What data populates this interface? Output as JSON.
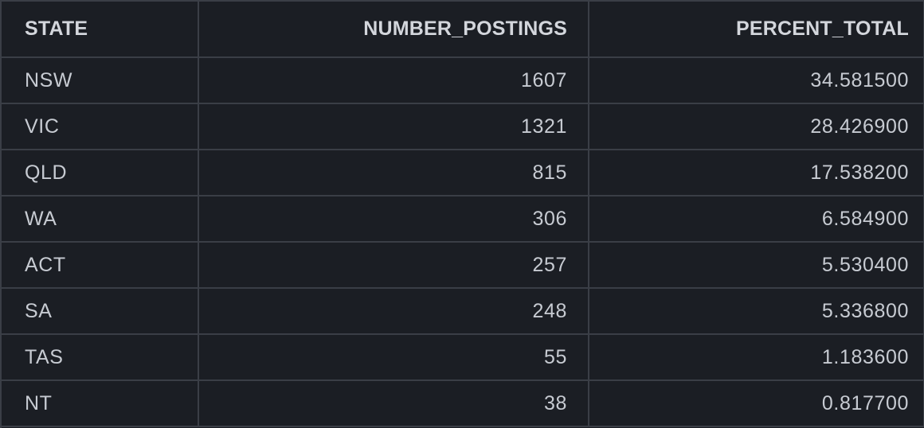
{
  "table": {
    "columns": [
      "STATE",
      "NUMBER_POSTINGS",
      "PERCENT_TOTAL"
    ],
    "rows": [
      [
        "NSW",
        "1607",
        "34.581500"
      ],
      [
        "VIC",
        "1321",
        "28.426900"
      ],
      [
        "QLD",
        "815",
        "17.538200"
      ],
      [
        "WA",
        "306",
        "6.584900"
      ],
      [
        "ACT",
        "257",
        "5.530400"
      ],
      [
        "SA",
        "248",
        "5.336800"
      ],
      [
        "TAS",
        "55",
        "1.183600"
      ],
      [
        "NT",
        "38",
        "0.817700"
      ]
    ]
  },
  "colors": {
    "background": "#1b1e24",
    "grid_line": "#3a3e46",
    "header_text": "#d3d6dc",
    "cell_text": "#c7cbd2"
  }
}
